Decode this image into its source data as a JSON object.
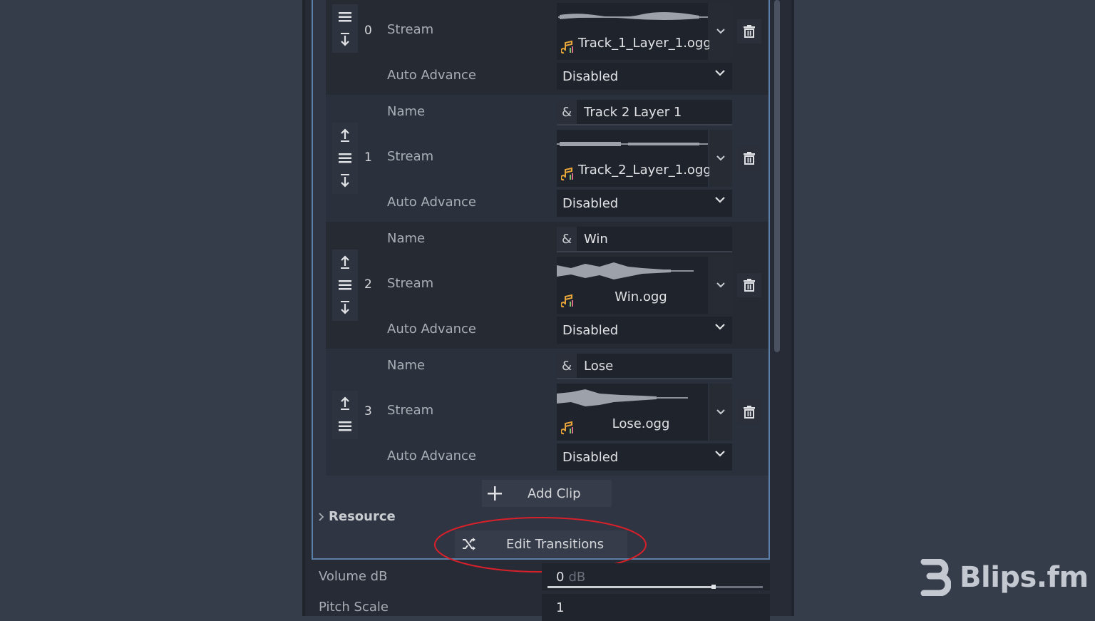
{
  "colors": {
    "accent": "#5c7fa8",
    "annotation": "#d8202a",
    "music_icon": "#e8a53a"
  },
  "labels": {
    "name": "Name",
    "stream": "Stream",
    "auto_advance": "Auto Advance"
  },
  "clips": [
    {
      "index": "0",
      "name": "",
      "stream_file": "Track_1_Layer_1.ogg",
      "auto_advance": "Disabled"
    },
    {
      "index": "1",
      "name": "Track 2 Layer 1",
      "stream_file": "Track_2_Layer_1.ogg",
      "auto_advance": "Disabled"
    },
    {
      "index": "2",
      "name": "Win",
      "stream_file": "Win.ogg",
      "auto_advance": "Disabled"
    },
    {
      "index": "3",
      "name": "Lose",
      "stream_file": "Lose.ogg",
      "auto_advance": "Disabled"
    }
  ],
  "name_prefix_icon": "&",
  "add_clip_label": "Add Clip",
  "resource_label": "Resource",
  "edit_transitions_label": "Edit Transitions",
  "properties": {
    "volume_label": "Volume dB",
    "volume_value": "0",
    "volume_unit": "dB",
    "volume_slider_fraction": 0.77,
    "pitch_label": "Pitch Scale",
    "pitch_value": "1"
  },
  "brand": {
    "name": "Blips.fm",
    "logo_icon": "blips-logo-icon"
  }
}
